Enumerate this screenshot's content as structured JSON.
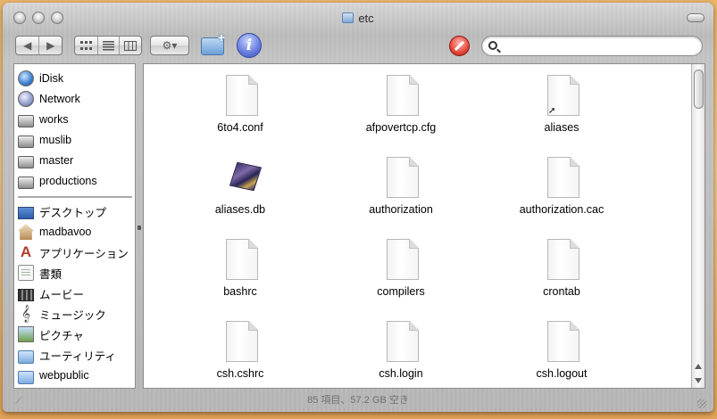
{
  "window": {
    "title": "etc"
  },
  "toolbar": {
    "back_glyph": "◀",
    "forward_glyph": "▶",
    "action_glyph": "⚙▾",
    "info_glyph": "i",
    "search_placeholder": ""
  },
  "sidebar": {
    "devices": [
      {
        "label": "iDisk",
        "icon": "idisk-icon"
      },
      {
        "label": "Network",
        "icon": "network-icon"
      },
      {
        "label": "works",
        "icon": "drive-icon"
      },
      {
        "label": "muslib",
        "icon": "drive-icon"
      },
      {
        "label": "master",
        "icon": "drive-icon"
      },
      {
        "label": "productions",
        "icon": "drive-icon"
      }
    ],
    "places": [
      {
        "label": "デスクトップ",
        "icon": "desktop-icon"
      },
      {
        "label": "madbavoo",
        "icon": "home-icon"
      },
      {
        "label": "アプリケーション",
        "icon": "applications-icon"
      },
      {
        "label": "書類",
        "icon": "documents-icon"
      },
      {
        "label": "ムービー",
        "icon": "movies-icon"
      },
      {
        "label": "ミュージック",
        "icon": "music-icon"
      },
      {
        "label": "ピクチャ",
        "icon": "pictures-icon"
      },
      {
        "label": "ユーティリティ",
        "icon": "folder-icon"
      },
      {
        "label": "webpublic",
        "icon": "folder-icon"
      }
    ]
  },
  "files": [
    {
      "name": "6to4.conf",
      "icon": "document-icon"
    },
    {
      "name": "afpovertcp.cfg",
      "icon": "document-icon"
    },
    {
      "name": "aliases",
      "icon": "alias-document-icon"
    },
    {
      "name": "aliases.db",
      "icon": "database-cube-icon"
    },
    {
      "name": "authorization",
      "icon": "document-icon"
    },
    {
      "name": "authorization.cac",
      "icon": "document-icon"
    },
    {
      "name": "bashrc",
      "icon": "document-icon"
    },
    {
      "name": "compilers",
      "icon": "document-icon"
    },
    {
      "name": "crontab",
      "icon": "document-icon"
    },
    {
      "name": "csh.cshrc",
      "icon": "document-icon"
    },
    {
      "name": "csh.login",
      "icon": "document-icon"
    },
    {
      "name": "csh.logout",
      "icon": "document-icon"
    }
  ],
  "status": {
    "text": "85 項目、57.2 GB 空き"
  },
  "colors": {
    "desktop": "#e9b46a",
    "metal": "#c0c0c0",
    "accent": "#3b51b8"
  }
}
